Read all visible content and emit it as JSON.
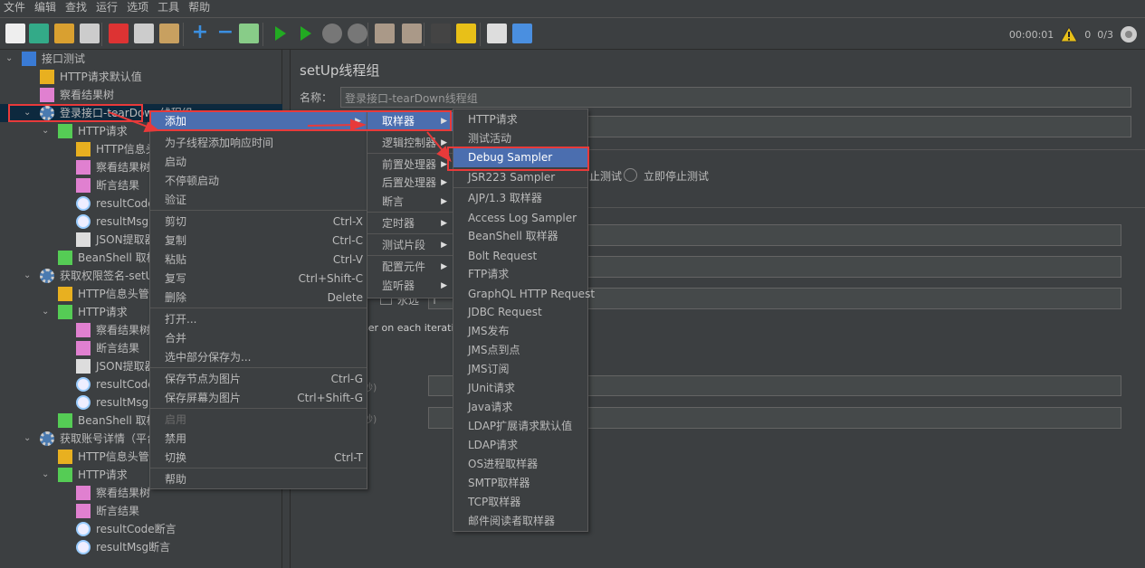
{
  "menubar": [
    "文件",
    "编辑",
    "查找",
    "运行",
    "选项",
    "工具",
    "帮助"
  ],
  "toolbar": {
    "icons": [
      "new-icon",
      "templates-icon",
      "open-icon",
      "save-icon",
      "cut-icon",
      "copy-icon",
      "paste-icon",
      "expand-icon",
      "collapse-icon",
      "toggle-icon",
      "start-icon",
      "start-no-pause-icon",
      "stop-icon",
      "shutdown-icon",
      "clear-icon",
      "clear-all-icon",
      "search-icon",
      "reset-search-icon",
      "function-helper-icon",
      "help-icon"
    ]
  },
  "status": {
    "timer": "00:00:01",
    "warnings": "0",
    "threads": "0/3",
    "warning_color": "#e8c018"
  },
  "tree": [
    {
      "label": "接口测试",
      "level": 0,
      "icon": "flask-icon",
      "chev": true
    },
    {
      "label": "HTTP请求默认值",
      "level": 1,
      "icon": "wrench-icon"
    },
    {
      "label": "察看结果树",
      "level": 1,
      "icon": "chart-icon"
    },
    {
      "label": "登录接口-tearDown线程组",
      "level": 1,
      "icon": "gear-icon",
      "chev": true,
      "selected": true
    },
    {
      "label": "HTTP请求",
      "level": 2,
      "icon": "pipette-icon",
      "chev": true
    },
    {
      "label": "HTTP信息头管理器",
      "level": 3,
      "icon": "wrench-icon"
    },
    {
      "label": "察看结果树",
      "level": 3,
      "icon": "chart-icon"
    },
    {
      "label": "断言结果",
      "level": 3,
      "icon": "chart-icon"
    },
    {
      "label": "resultCode断言",
      "level": 3,
      "icon": "magnifier-icon"
    },
    {
      "label": "resultMsg断言",
      "level": 3,
      "icon": "magnifier-icon"
    },
    {
      "label": "JSON提取器",
      "level": 3,
      "icon": "extractor-icon"
    },
    {
      "label": "BeanShell 取样器",
      "level": 2,
      "icon": "pipette-icon"
    },
    {
      "label": "获取权限签名-setUp线程组",
      "level": 1,
      "icon": "gear-icon",
      "chev": true
    },
    {
      "label": "HTTP信息头管理器",
      "level": 2,
      "icon": "wrench-icon"
    },
    {
      "label": "HTTP请求",
      "level": 2,
      "icon": "pipette-icon",
      "chev": true
    },
    {
      "label": "察看结果树",
      "level": 3,
      "icon": "chart-icon"
    },
    {
      "label": "断言结果",
      "level": 3,
      "icon": "chart-icon"
    },
    {
      "label": "JSON提取器",
      "level": 3,
      "icon": "extractor-icon"
    },
    {
      "label": "resultCode断言",
      "level": 3,
      "icon": "magnifier-icon"
    },
    {
      "label": "resultMsg断言",
      "level": 3,
      "icon": "magnifier-icon"
    },
    {
      "label": "BeanShell 取样器",
      "level": 2,
      "icon": "pipette-icon"
    },
    {
      "label": "获取账号详情（平台",
      "level": 1,
      "icon": "gear-icon",
      "chev": true
    },
    {
      "label": "HTTP信息头管理器",
      "level": 2,
      "icon": "wrench-icon"
    },
    {
      "label": "HTTP请求",
      "level": 2,
      "icon": "pipette-icon",
      "chev": true
    },
    {
      "label": "察看结果树",
      "level": 3,
      "icon": "chart-icon"
    },
    {
      "label": "断言结果",
      "level": 3,
      "icon": "chart-icon"
    },
    {
      "label": "resultCode断言",
      "level": 3,
      "icon": "magnifier-icon"
    },
    {
      "label": "resultMsg断言",
      "level": 3,
      "icon": "magnifier-icon"
    }
  ],
  "panel": {
    "title": "setUp线程组",
    "name_label": "名称：",
    "name_value": "登录接口-tearDown线程组",
    "stop_test_fragment": "止测试",
    "stop_now": "立即停止测试",
    "forever": "永远",
    "same_user_fragment": "ser on each iterati",
    "sec1": "秒)",
    "sec2": "秒)"
  },
  "context_menu": [
    {
      "label": "添加",
      "submenu": true,
      "highlighted": true
    },
    {
      "label": "为子线程添加响应时间"
    },
    {
      "label": "启动"
    },
    {
      "label": "不停顿启动"
    },
    {
      "label": "验证"
    },
    {
      "sep": true
    },
    {
      "label": "剪切",
      "shortcut": "Ctrl-X"
    },
    {
      "label": "复制",
      "shortcut": "Ctrl-C"
    },
    {
      "label": "粘贴",
      "shortcut": "Ctrl-V"
    },
    {
      "label": "复写",
      "shortcut": "Ctrl+Shift-C"
    },
    {
      "label": "删除",
      "shortcut": "Delete"
    },
    {
      "sep": true
    },
    {
      "label": "打开..."
    },
    {
      "label": "合并"
    },
    {
      "label": "选中部分保存为..."
    },
    {
      "sep": true
    },
    {
      "label": "保存节点为图片",
      "shortcut": "Ctrl-G"
    },
    {
      "label": "保存屏幕为图片",
      "shortcut": "Ctrl+Shift-G"
    },
    {
      "sep": true
    },
    {
      "label": "启用",
      "disabled": true
    },
    {
      "label": "禁用"
    },
    {
      "label": "切换",
      "shortcut": "Ctrl-T"
    },
    {
      "sep": true
    },
    {
      "label": "帮助"
    }
  ],
  "add_menu": [
    {
      "label": "取样器",
      "submenu": true,
      "highlighted": true
    },
    {
      "label": "逻辑控制器",
      "submenu": true
    },
    {
      "sep": true
    },
    {
      "label": "前置处理器",
      "submenu": true
    },
    {
      "label": "后置处理器",
      "submenu": true
    },
    {
      "label": "断言",
      "submenu": true
    },
    {
      "sep": true
    },
    {
      "label": "定时器",
      "submenu": true
    },
    {
      "sep": true
    },
    {
      "label": "测试片段",
      "submenu": true
    },
    {
      "sep": true
    },
    {
      "label": "配置元件",
      "submenu": true
    },
    {
      "label": "监听器",
      "submenu": true
    }
  ],
  "sampler_menu": [
    {
      "label": "HTTP请求"
    },
    {
      "label": "测试活动"
    },
    {
      "label": "Debug Sampler",
      "highlighted": true
    },
    {
      "label": "JSR223 Sampler"
    },
    {
      "sep": true
    },
    {
      "label": "AJP/1.3 取样器"
    },
    {
      "label": "Access Log Sampler"
    },
    {
      "label": "BeanShell 取样器"
    },
    {
      "label": "Bolt Request"
    },
    {
      "label": "FTP请求"
    },
    {
      "label": "GraphQL HTTP Request"
    },
    {
      "label": "JDBC Request"
    },
    {
      "label": "JMS发布"
    },
    {
      "label": "JMS点到点"
    },
    {
      "label": "JMS订阅"
    },
    {
      "label": "JUnit请求"
    },
    {
      "label": "Java请求"
    },
    {
      "label": "LDAP扩展请求默认值"
    },
    {
      "label": "LDAP请求"
    },
    {
      "label": "OS进程取样器"
    },
    {
      "label": "SMTP取样器"
    },
    {
      "label": "TCP取样器"
    },
    {
      "label": "邮件阅读者取样器"
    }
  ],
  "colors": {
    "highlight": "#4b6eaf",
    "annotation": "#e83a3a",
    "selected_row": "#0d293e"
  }
}
